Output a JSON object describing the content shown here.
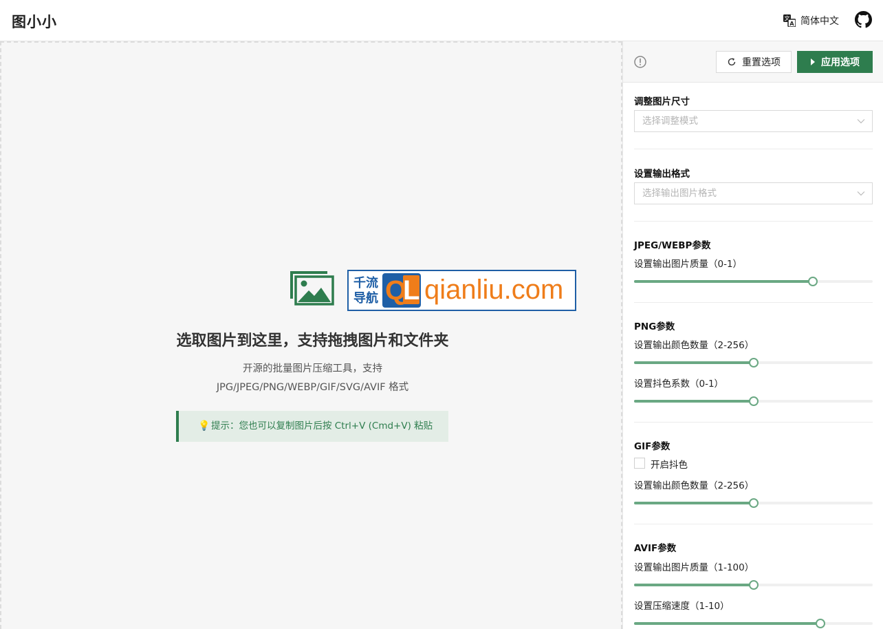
{
  "header": {
    "app_title": "图小小",
    "language": "简体中文",
    "lang_icon": "translate-icon",
    "github_icon": "github-icon"
  },
  "dropzone": {
    "brand_cn_line1": "千流",
    "brand_cn_line2": "导航",
    "brand_ql_q": "Q",
    "brand_ql_l": "L",
    "brand_url": "qianliu.com",
    "title": "选取图片到这里，支持拖拽图片和文件夹",
    "subtitle_line1": "开源的批量图片压缩工具，支持",
    "subtitle_line2": "JPG/JPEG/PNG/WEBP/GIF/SVG/AVIF 格式",
    "hint_icon": "💡",
    "hint": "提示：您也可以复制图片后按 Ctrl+V (Cmd+V) 粘贴"
  },
  "panel": {
    "reset_label": "重置选项",
    "apply_label": "应用选项",
    "resize": {
      "title": "调整图片尺寸",
      "placeholder": "选择调整模式"
    },
    "output_format": {
      "title": "设置输出格式",
      "placeholder": "选择输出图片格式"
    },
    "jpeg_webp": {
      "title": "JPEG/WEBP参数",
      "quality_label": "设置输出图片质量（0-1）",
      "quality_value": 0.75
    },
    "png": {
      "title": "PNG参数",
      "colors_label": "设置输出颜色数量（2-256）",
      "colors_fraction": 0.5,
      "dither_label": "设置抖色系数（0-1）",
      "dither_value": 0.5
    },
    "gif": {
      "title": "GIF参数",
      "dither_checkbox_label": "开启抖色",
      "dither_checked": false,
      "colors_label": "设置输出颜色数量（2-256）",
      "colors_fraction": 0.5
    },
    "avif": {
      "title": "AVIF参数",
      "quality_label": "设置输出图片质量（1-100）",
      "quality_fraction": 0.5,
      "speed_label": "设置压缩速度（1-10）",
      "speed_fraction": 0.78
    }
  },
  "colors": {
    "accent": "#2e7d4e",
    "slider": "#6aa883",
    "brand_blue": "#1f5fa6",
    "brand_orange": "#ef7d1a"
  }
}
